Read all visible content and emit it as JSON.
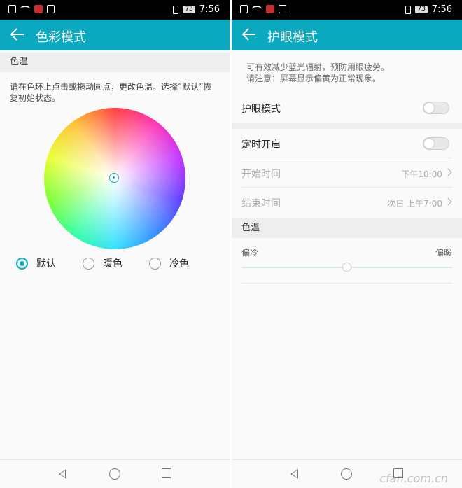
{
  "status_bar": {
    "battery": "73",
    "time": "7:56"
  },
  "left": {
    "title": "色彩模式",
    "section_label": "色温",
    "description": "请在色环上点击或拖动圆点，更改色温。选择“默认”恢复初始状态。",
    "options": [
      {
        "label": "默认",
        "selected": true
      },
      {
        "label": "暖色",
        "selected": false
      },
      {
        "label": "冷色",
        "selected": false
      }
    ]
  },
  "right": {
    "title": "护眼模式",
    "description": [
      "可有效减少蓝光辐射，预防用眼疲劳。",
      "请注意：屏幕显示偏黄为正常现象。"
    ],
    "eye_mode": {
      "label": "护眼模式",
      "on": false
    },
    "schedule": {
      "label": "定时开启",
      "on": false
    },
    "start": {
      "label": "开始时间",
      "value": "下午10:00"
    },
    "end": {
      "label": "结束时间",
      "value": "次日 上午7:00"
    },
    "temp_section": "色温",
    "slider": {
      "left": "偏冷",
      "right": "偏暖",
      "level": 0.5
    }
  },
  "watermark": "cfan.com.cn",
  "colors": {
    "accent": "#0aa9bf"
  }
}
